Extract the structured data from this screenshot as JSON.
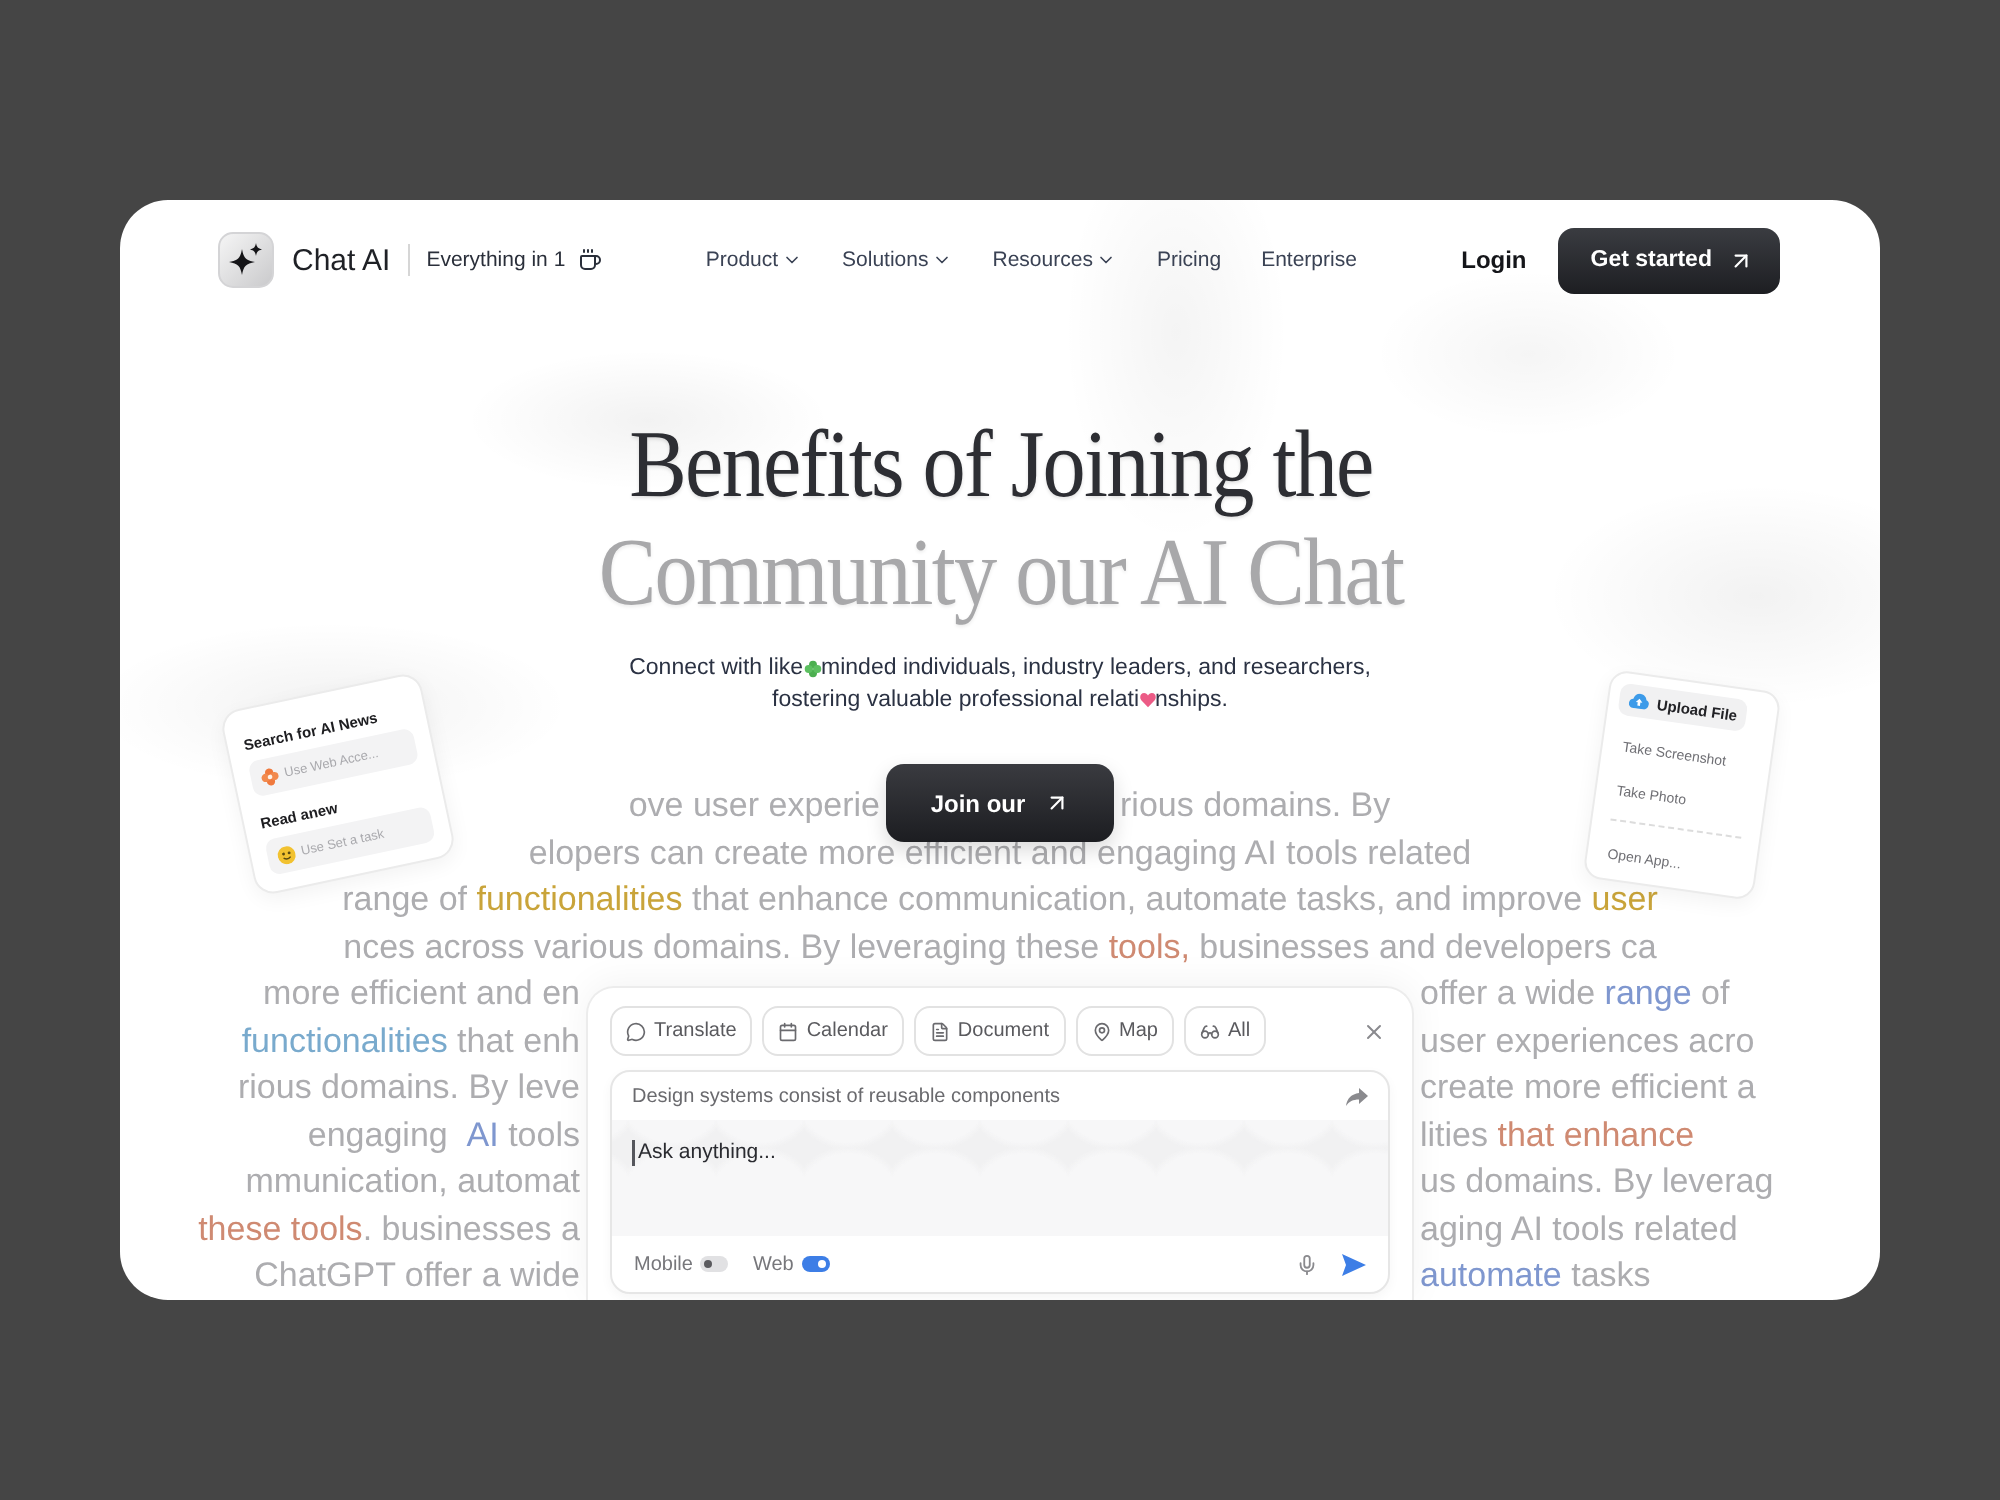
{
  "header": {
    "brand": "Chat AI",
    "tagline": "Everything in 1",
    "nav": [
      {
        "label": "Product",
        "dropdown": true
      },
      {
        "label": "Solutions",
        "dropdown": true
      },
      {
        "label": "Resources",
        "dropdown": true
      },
      {
        "label": "Pricing",
        "dropdown": false
      },
      {
        "label": "Enterprise",
        "dropdown": false
      }
    ],
    "login": "Login",
    "cta": "Get started"
  },
  "hero": {
    "title": [
      {
        "text": "Benefits of Joining the",
        "muted": false
      },
      {
        "text": "Community our AI Chat",
        "muted": true
      }
    ],
    "subtitle": [
      {
        "before": "Connect with like",
        "after": "minded individuals, industry leaders, and researchers,"
      },
      {
        "before": "fostering valuable professional relati",
        "after": "nships."
      }
    ],
    "button": "Join our"
  },
  "search_card": {
    "sections": [
      {
        "title": "Search for AI News",
        "placeholder": "Use Web Acce..."
      },
      {
        "title": "Read anew",
        "placeholder": "Use Set a task"
      }
    ]
  },
  "attach_menu": {
    "groups": [
      [
        {
          "label": "Upload File",
          "selected": true
        },
        {
          "label": "Take Screenshot",
          "selected": false
        },
        {
          "label": "Take Photo",
          "selected": false
        }
      ],
      [
        {
          "label": "Open App...",
          "selected": false
        }
      ]
    ]
  },
  "background_text": [
    {
      "kind": "around-button",
      "left": [
        {
          "text": "ove user experie"
        }
      ],
      "right": [
        {
          "text": "rious domains. By"
        }
      ]
    },
    {
      "kind": "full",
      "runs": [
        {
          "text": "elopers can create more efficient and engaging AI tools related"
        }
      ]
    },
    {
      "kind": "full",
      "runs": [
        {
          "text": "range of "
        },
        {
          "text": "functionalities",
          "color": "#c9a43a"
        },
        {
          "text": " that enhance communication, automate tasks, and improve "
        },
        {
          "text": "user",
          "color": "#c9a43a"
        }
      ]
    },
    {
      "kind": "full",
      "runs": [
        {
          "text": "nces across various domains. By leveraging these "
        },
        {
          "text": "tools,",
          "color": "#cf8a72"
        },
        {
          "text": " businesses and developers ca"
        }
      ]
    },
    {
      "kind": "around-panel",
      "left": [
        {
          "text": "more efficient and en"
        }
      ],
      "right": [
        {
          "text": "offer a wide "
        },
        {
          "text": "range",
          "color": "#7f97cf"
        },
        {
          "text": " of"
        }
      ]
    },
    {
      "kind": "around-panel",
      "left": [
        {
          "text": "functionalities",
          "color": "#79aacd"
        },
        {
          "text": " that enh"
        }
      ],
      "right": [
        {
          "text": "user experiences acro"
        }
      ]
    },
    {
      "kind": "around-panel",
      "left": [
        {
          "text": "rious domains. By leve"
        }
      ],
      "right": [
        {
          "text": "create more efficient a"
        }
      ]
    },
    {
      "kind": "around-panel",
      "left": [
        {
          "text": "engaging  "
        },
        {
          "text": "AI",
          "color": "#7f97cf"
        },
        {
          "text": " tools"
        }
      ],
      "right": [
        {
          "text": "lities "
        },
        {
          "text": "that enhance",
          "color": "#cf8a72"
        }
      ]
    },
    {
      "kind": "around-panel",
      "left": [
        {
          "text": "mmunication, automat"
        }
      ],
      "right": [
        {
          "text": "us domains. By leverag"
        }
      ]
    },
    {
      "kind": "around-panel",
      "left": [
        {
          "text": "these tools",
          "color": "#cf8a72"
        },
        {
          "text": ". businesses a"
        }
      ],
      "right": [
        {
          "text": "aging AI tools related"
        }
      ]
    },
    {
      "kind": "around-panel",
      "left": [
        {
          "text": "ChatGPT offer a wide"
        }
      ],
      "right": [
        {
          "text": "automate",
          "color": "#7f97cf"
        },
        {
          "text": " tasks"
        }
      ]
    }
  ],
  "chat_panel": {
    "chips": [
      {
        "label": "Translate"
      },
      {
        "label": "Calendar"
      },
      {
        "label": "Document"
      },
      {
        "label": "Map"
      },
      {
        "label": "All"
      }
    ],
    "suggestion": "Design systems consist of reusable components",
    "input": {
      "placeholder": "Ask anything..."
    },
    "toggles": [
      {
        "label": "Mobile",
        "on": false
      },
      {
        "label": "Web",
        "on": true
      }
    ]
  }
}
